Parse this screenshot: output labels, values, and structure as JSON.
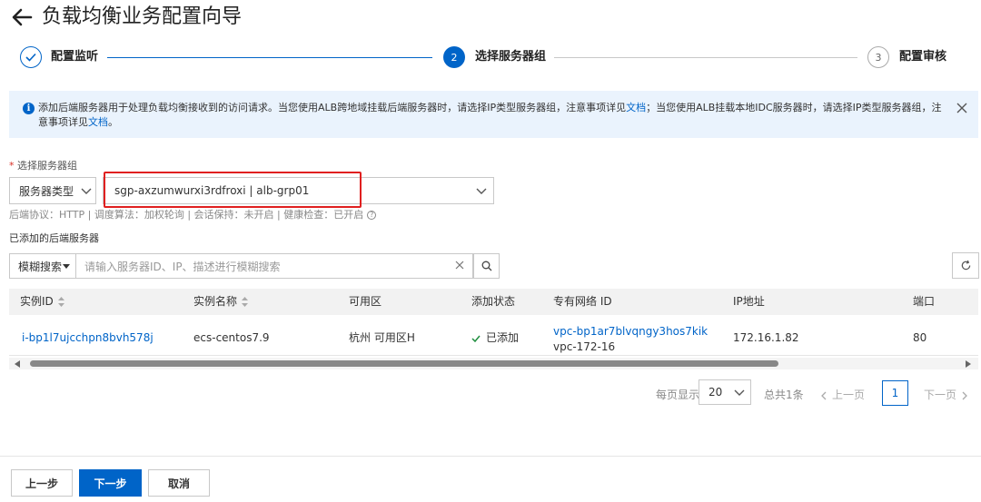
{
  "header": {
    "title": "负载均衡业务配置向导"
  },
  "steps": [
    {
      "num": "",
      "label": "配置监听",
      "state": "done"
    },
    {
      "num": "2",
      "label": "选择服务器组",
      "state": "active"
    },
    {
      "num": "3",
      "label": "配置审核",
      "state": "wait"
    }
  ],
  "alert": {
    "part1": "添加后端服务器用于处理负载均衡接收到的访问请求。当您使用ALB跨地域挂载后端服务器时，请选择IP类型服务器组，注意事项详见",
    "link1": "文档",
    "part2": "；当您使用ALB挂载本地IDC服务器时，请选择IP类型服务器组，注意事项详见",
    "link2": "文档",
    "part3": "。"
  },
  "form": {
    "group_label": "选择服务器组",
    "required_mark": "*",
    "type_select": "服务器类型",
    "group_select": "sgp-axzumwurxi3rdfroxi | alb-grp01",
    "meta": "后端协议：HTTP | 调度算法：加权轮询 | 会话保持：未开启 | 健康检查：已开启",
    "help_glyph": "?",
    "added_label": "已添加的后端服务器"
  },
  "search": {
    "mode": "模糊搜索",
    "placeholder": "请输入服务器ID、IP、描述进行模糊搜索"
  },
  "table": {
    "headers": [
      "实例ID",
      "实例名称",
      "可用区",
      "添加状态",
      "专有网络 ID",
      "IP地址",
      "端口"
    ],
    "row": {
      "instance_id": "i-bp1l7ujcchpn8bvh578j",
      "instance_name": "ecs-centos7.9",
      "zone": "杭州 可用区H",
      "status": "已添加",
      "vpc_id": "vpc-bp1ar7blvqngy3hos7kik",
      "vpc_name": "vpc-172-16",
      "ip": "172.16.1.82",
      "port": "80"
    }
  },
  "pagination": {
    "per_page_label": "每页显示",
    "per_page": "20",
    "total": "总共1条",
    "prev": "上一页",
    "current": "1",
    "next": "下一页"
  },
  "footer": {
    "prev": "上一步",
    "next": "下一步",
    "cancel": "取消"
  },
  "colors": {
    "primary": "#0064c8",
    "alert_bg": "#eaf3fd",
    "success": "#1e8e3e",
    "highlight": "#e02020"
  }
}
